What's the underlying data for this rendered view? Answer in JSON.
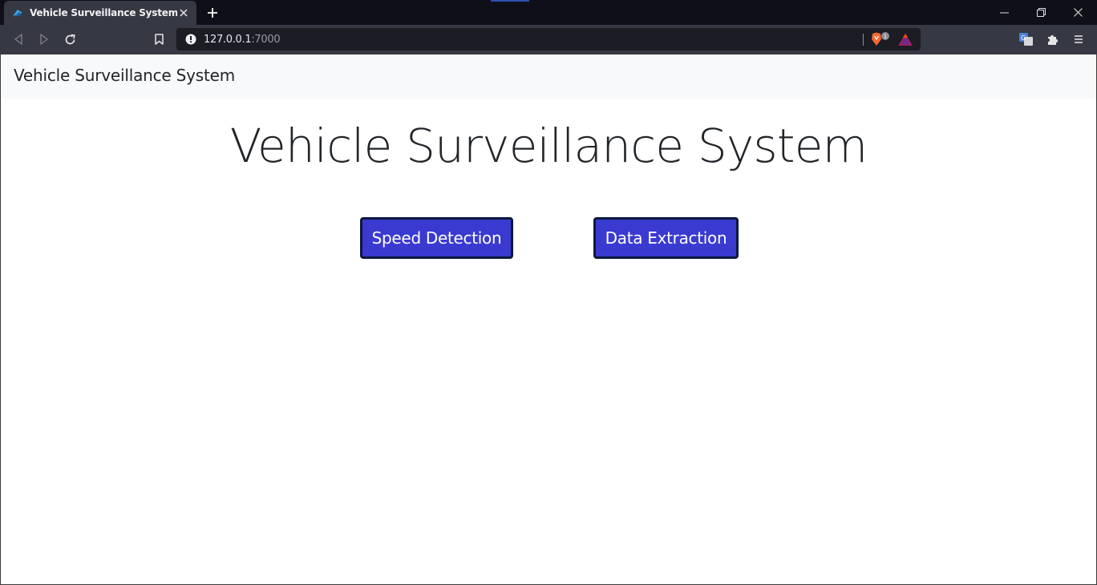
{
  "browser": {
    "tab_title": "Vehicle Surveillance System",
    "url_host": "127.0.0.1",
    "url_port": ":7000",
    "shield_badge": "1"
  },
  "navbar": {
    "brand": "Vehicle Surveillance System"
  },
  "main": {
    "heading": "Vehicle Surveillance System",
    "buttons": {
      "speed_detection": "Speed Detection",
      "data_extraction": "Data Extraction"
    }
  },
  "colors": {
    "button_bg": "#3a3ad1",
    "button_border": "#0b1a3a",
    "navbar_bg": "#f8f9fa"
  }
}
